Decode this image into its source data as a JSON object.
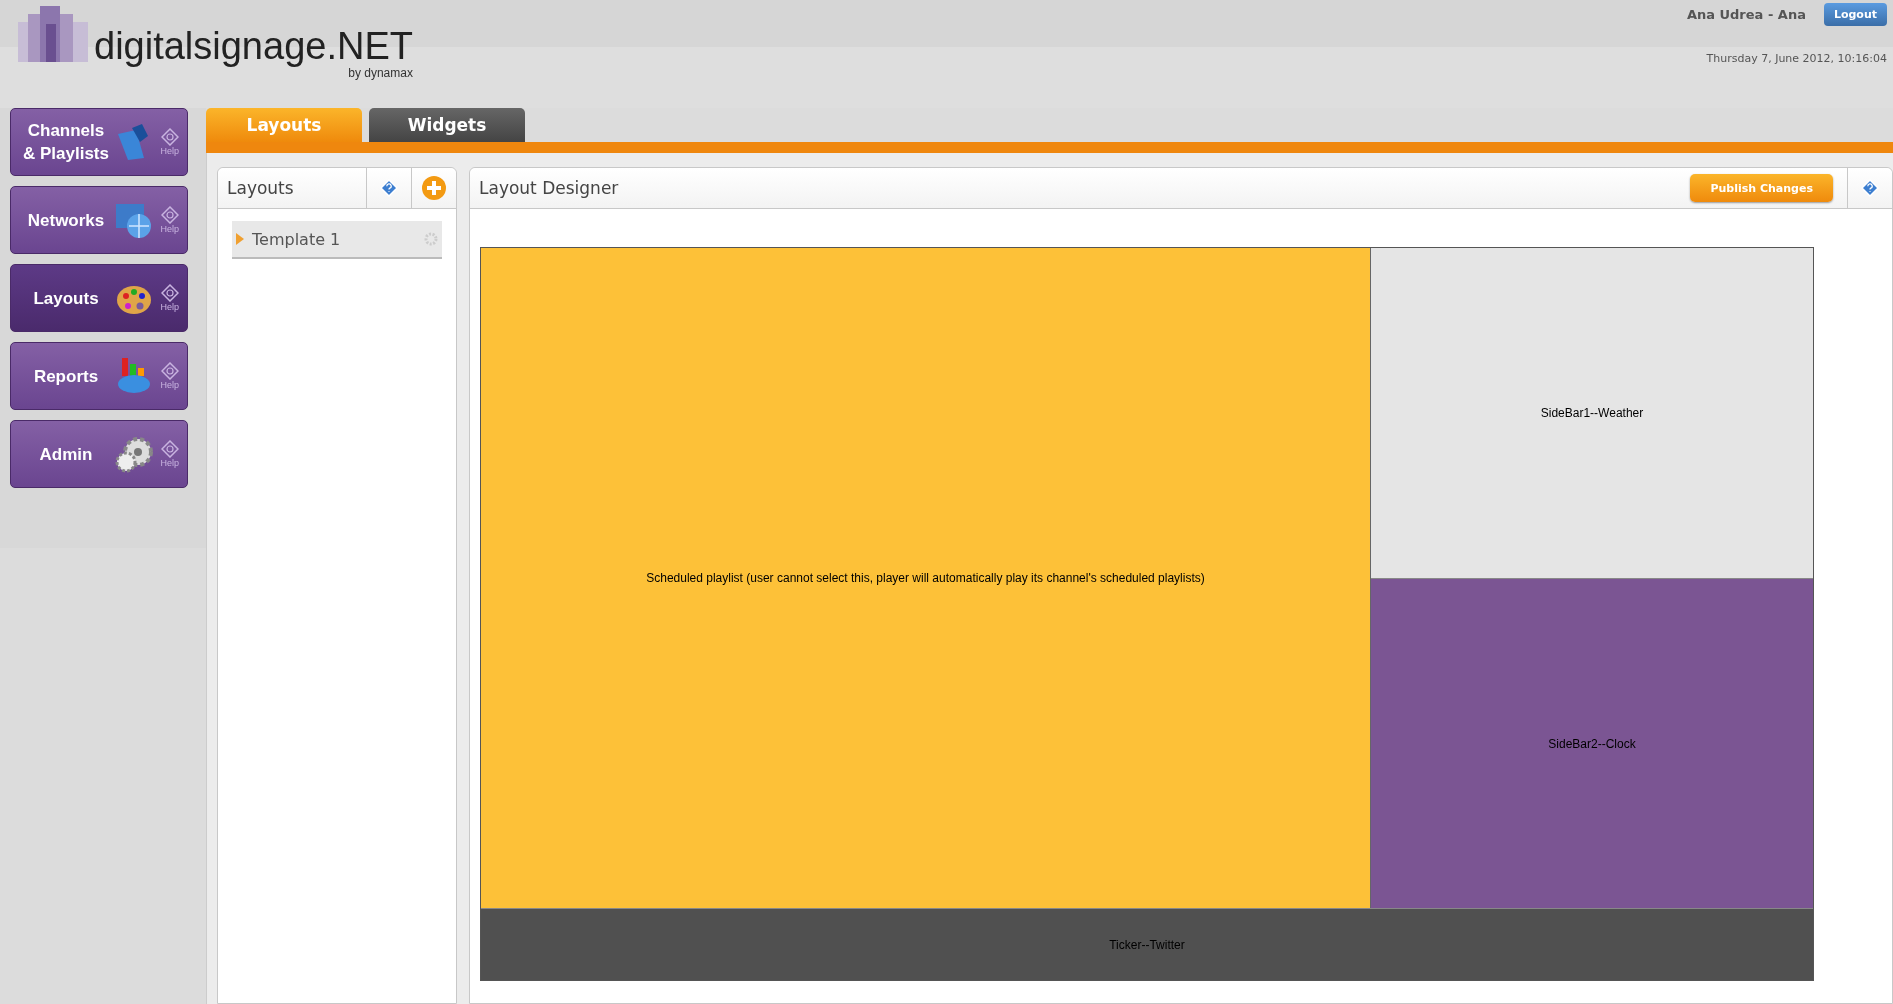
{
  "logo": {
    "name": "digitalsignage.NET",
    "byline": "by dynamax"
  },
  "user": {
    "name": "Ana Udrea - Ana",
    "logout": "Logout",
    "datetime": "Thursday 7, June 2012, 10:16:04"
  },
  "nav": [
    {
      "label": "Channels & Playlists",
      "kind": "folder",
      "help": "Help",
      "selected": false
    },
    {
      "label": "Networks",
      "kind": "globe",
      "help": "Help",
      "selected": false
    },
    {
      "label": "Layouts",
      "kind": "palette",
      "help": "Help",
      "selected": true
    },
    {
      "label": "Reports",
      "kind": "chart",
      "help": "Help",
      "selected": false
    },
    {
      "label": "Admin",
      "kind": "gears",
      "help": "Help",
      "selected": false
    }
  ],
  "tabs": [
    {
      "label": "Layouts",
      "selected": true
    },
    {
      "label": "Widgets",
      "selected": false
    }
  ],
  "layouts_panel": {
    "title": "Layouts",
    "items": [
      {
        "label": "Template 1",
        "selected": true
      }
    ]
  },
  "designer": {
    "title": "Layout Designer",
    "publish": "Publish Changes",
    "zones": [
      {
        "label": "Scheduled playlist (user cannot select this, player will automatically play its channel's scheduled playlists)",
        "color": "#fdc138"
      },
      {
        "label": "SideBar1--Weather",
        "color": "#e5e5e5"
      },
      {
        "label": "SideBar2--Clock",
        "color": "#7b5593"
      },
      {
        "label": "Ticker--Twitter",
        "color": "#505050"
      }
    ]
  }
}
